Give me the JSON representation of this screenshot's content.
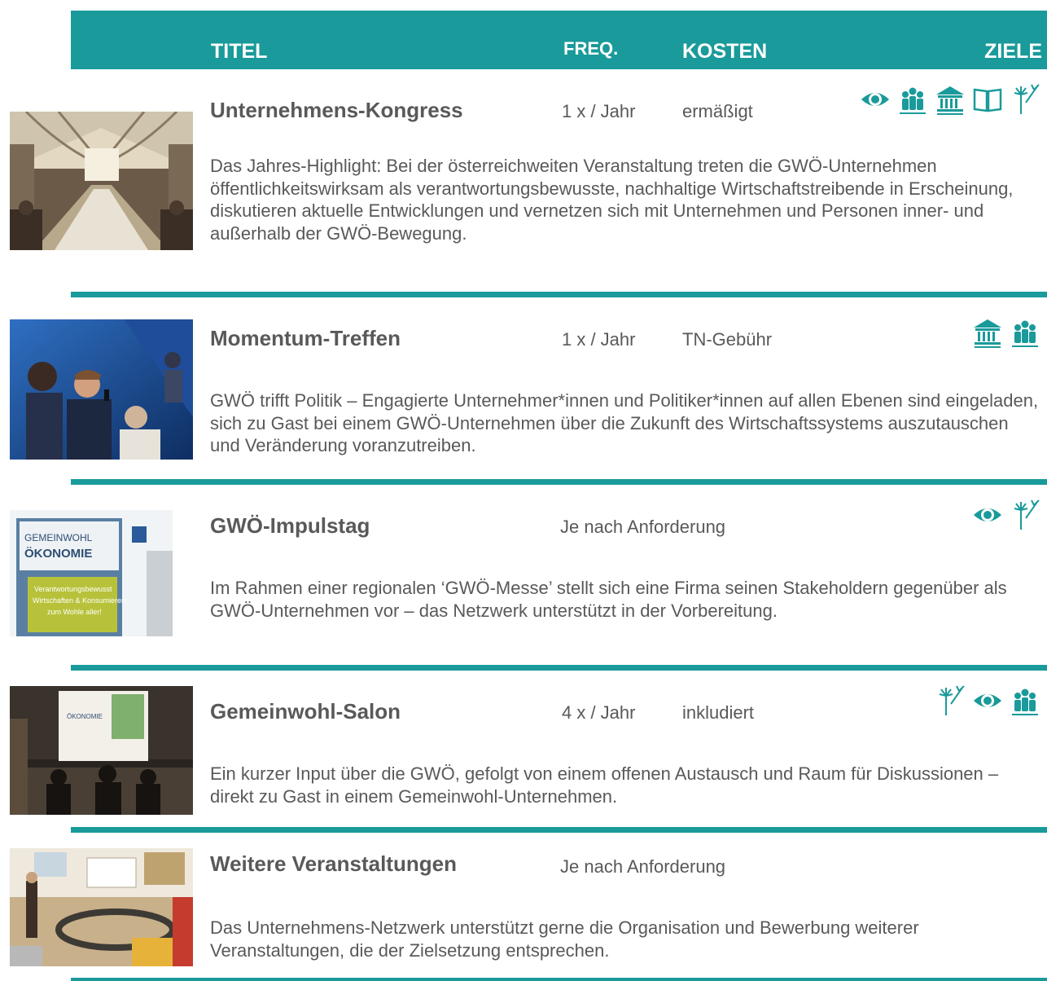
{
  "header": {
    "title_label": "TITEL",
    "freq_label": "FREQ.",
    "cost_label": "KOSTEN",
    "goals_label": "ZIELE"
  },
  "colors": {
    "accent": "#1a9a9a",
    "text": "#595959"
  },
  "events": [
    {
      "title": "Unternehmens-Kongress",
      "freq": "1 x / Jahr",
      "cost": "ermäßigt",
      "description": "Das Jahres-Highlight: Bei der österreichweiten Veranstaltung treten die GWÖ-Unternehmen öffentlichkeitswirksam als verantwortungsbewusste, nachhaltige Wirtschaftstreibende in Erscheinung, diskutieren aktuelle Entwicklungen und vernetzen sich mit Unternehmen und Personen inner- und außerhalb der GWÖ-Bewegung.",
      "icons": [
        "eye-icon",
        "people-icon",
        "institution-icon",
        "book-icon",
        "dandelion-icon"
      ]
    },
    {
      "title": "Momentum-Treffen",
      "freq": "1 x / Jahr",
      "cost": "TN-Gebühr",
      "description": "GWÖ trifft Politik – Engagierte Unternehmer*innen und Politiker*innen auf allen Ebenen sind eingeladen, sich zu Gast bei einem GWÖ-Unternehmen über die Zukunft des Wirtschaftssystems auszutauschen und Veränderung voranzutreiben.",
      "icons": [
        "institution-icon",
        "people-icon"
      ]
    },
    {
      "title": "GWÖ-Impulstag",
      "freq": "Je nach Anforderung",
      "cost": "",
      "description": "Im Rahmen einer regionalen ‘GWÖ-Messe’ stellt sich eine Firma seinen Stakeholdern gegenüber als GWÖ-Unternehmen vor – das Netzwerk unterstützt in der Vorbereitung.",
      "icons": [
        "eye-icon",
        "dandelion-icon"
      ]
    },
    {
      "title": "Gemeinwohl-Salon",
      "freq": "4 x / Jahr",
      "cost": "inkludiert",
      "description": "Ein kurzer Input über die GWÖ, gefolgt von einem offenen Austausch und Raum für Diskussionen – direkt zu Gast in einem Gemeinwohl-Unternehmen.",
      "icons": [
        "dandelion-icon",
        "eye-icon",
        "people-icon"
      ]
    },
    {
      "title": "Weitere Veranstaltungen",
      "freq": "Je nach Anforderung",
      "cost": "",
      "description": "Das Unternehmens-Netzwerk unterstützt gerne die Organisation und Bewerbung weiterer Veranstaltungen, die der Zielsetzung entsprechen.",
      "icons": []
    }
  ],
  "photo_sign": {
    "line1": "GEMEINWOHL",
    "line2": "ÖKONOMIE",
    "line3": "Verantwortungsbewusst",
    "line4": "Wirtschaften & Konsumieren",
    "line5": "zum Wohle aller!"
  }
}
